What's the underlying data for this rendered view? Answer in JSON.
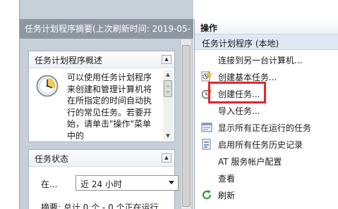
{
  "summary_pane": {
    "header": "任务计划程序摘要(上次刷新时间: 2019-05-",
    "overview": {
      "title": "任务计划程序概述",
      "description": "可以使用任务计划程序来创建和管理计算机将在所指定的时间自动执行的常见任务。若要开始，请单击\"操作\"菜单中的"
    },
    "status": {
      "title": "任务状态",
      "range_label": "在...",
      "range_value": "近 24 小时",
      "summary": "摘要: 总计 0 个 - 0 个正在运行..."
    }
  },
  "actions_pane": {
    "title": "操作",
    "section": "任务计划程序 (本地)",
    "items": [
      {
        "label": "连接到另一台计算机...",
        "icon": "none"
      },
      {
        "label": "创建基本任务...",
        "icon": "create-basic-task-icon"
      },
      {
        "label": "创建任务...",
        "icon": "create-task-icon"
      },
      {
        "label": "导入任务...",
        "icon": "none"
      },
      {
        "label": "显示所有正在运行的任务",
        "icon": "running-tasks-icon"
      },
      {
        "label": "启用所有任务历史记录",
        "icon": "task-history-icon"
      },
      {
        "label": "AT 服务帐户配置",
        "icon": "none"
      },
      {
        "label": "查看",
        "icon": "none"
      },
      {
        "label": "刷新",
        "icon": "refresh-icon"
      }
    ]
  },
  "colors": {
    "pane_background": "#c7cfd9",
    "header_background": "#8d96a1",
    "highlight_box": "#e3262b",
    "refresh_icon": "#2e9a38"
  }
}
